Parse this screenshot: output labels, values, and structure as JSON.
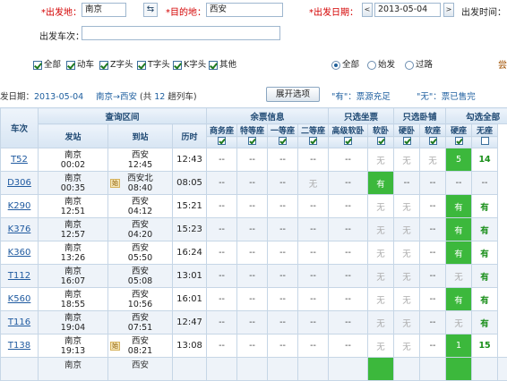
{
  "search": {
    "from_label": "*出发地：",
    "from_value": "南京",
    "swap_glyph": "⇆",
    "to_label": "*目的地：",
    "to_value": "西安",
    "date_label": "*出发日期：",
    "date_prev": "<",
    "date_value": "2013-05-04",
    "date_next": ">",
    "time_label": "出发时间：",
    "train_no_label": "出发车次：",
    "train_no_value": ""
  },
  "filters": {
    "types": [
      {
        "label": "全部",
        "checked": true
      },
      {
        "label": "动车",
        "checked": true
      },
      {
        "label": "Z字头",
        "checked": true
      },
      {
        "label": "T字头",
        "checked": true
      },
      {
        "label": "K字头",
        "checked": true
      },
      {
        "label": "其他",
        "checked": true
      }
    ],
    "station_types": [
      {
        "label": "全部",
        "selected": true
      },
      {
        "label": "始发",
        "selected": false
      },
      {
        "label": "过路",
        "selected": false
      }
    ],
    "edge_char": "尝"
  },
  "info": {
    "date_prefix": "发日期：",
    "date": "2013-05-04",
    "route": "南京→西安",
    "count_prefix": "(共",
    "count": "12",
    "count_suffix": "趟列车)",
    "expand_button": "展开选项",
    "legend_you": "\"有\"：票源充足",
    "legend_wu": "\"无\"：票已售完"
  },
  "table": {
    "group_headers": {
      "train": "车次",
      "interval": "查询区间",
      "remaining": "余票信息",
      "seat_only": "只选坐票",
      "sleeper_only": "只选卧铺",
      "select_all": "勾选全部"
    },
    "sub_headers": {
      "depart": "发站",
      "arrive": "到站",
      "duration": "历时"
    },
    "seat_classes": [
      "商务座",
      "特等座",
      "一等座",
      "二等座",
      "高级软卧",
      "软卧",
      "硬卧",
      "软座",
      "硬座",
      "无座"
    ],
    "seat_checked": [
      true,
      true,
      true,
      true,
      true,
      true,
      true,
      true,
      true,
      false
    ],
    "through_tag": "始",
    "rows": [
      {
        "train": "T52",
        "from": "南京",
        "from_time": "00:02",
        "to": "西安",
        "to_time": "12:45",
        "through": false,
        "duration": "12:43",
        "seats": [
          "--",
          "--",
          "--",
          "--",
          "--",
          "无",
          "无",
          "无",
          "5",
          "14"
        ]
      },
      {
        "train": "D306",
        "from": "南京",
        "from_time": "00:35",
        "to": "西安北",
        "to_time": "08:40",
        "through": true,
        "duration": "08:05",
        "seats": [
          "--",
          "--",
          "--",
          "无",
          "--",
          "有",
          "--",
          "--",
          "--",
          "--"
        ]
      },
      {
        "train": "K290",
        "from": "南京",
        "from_time": "12:51",
        "to": "西安",
        "to_time": "04:12",
        "through": false,
        "duration": "15:21",
        "seats": [
          "--",
          "--",
          "--",
          "--",
          "--",
          "无",
          "无",
          "--",
          "有",
          "有"
        ]
      },
      {
        "train": "K376",
        "from": "南京",
        "from_time": "12:57",
        "to": "西安",
        "to_time": "04:20",
        "through": false,
        "duration": "15:23",
        "seats": [
          "--",
          "--",
          "--",
          "--",
          "--",
          "无",
          "无",
          "--",
          "有",
          "有"
        ]
      },
      {
        "train": "K360",
        "from": "南京",
        "from_time": "13:26",
        "to": "西安",
        "to_time": "05:50",
        "through": false,
        "duration": "16:24",
        "seats": [
          "--",
          "--",
          "--",
          "--",
          "--",
          "无",
          "无",
          "--",
          "有",
          "有"
        ]
      },
      {
        "train": "T112",
        "from": "南京",
        "from_time": "16:07",
        "to": "西安",
        "to_time": "05:08",
        "through": false,
        "duration": "13:01",
        "seats": [
          "--",
          "--",
          "--",
          "--",
          "--",
          "无",
          "无",
          "--",
          "无",
          "有"
        ]
      },
      {
        "train": "K560",
        "from": "南京",
        "from_time": "18:55",
        "to": "西安",
        "to_time": "10:56",
        "through": false,
        "duration": "16:01",
        "seats": [
          "--",
          "--",
          "--",
          "--",
          "--",
          "无",
          "无",
          "--",
          "有",
          "有"
        ]
      },
      {
        "train": "T116",
        "from": "南京",
        "from_time": "19:04",
        "to": "西安",
        "to_time": "07:51",
        "through": false,
        "duration": "12:47",
        "seats": [
          "--",
          "--",
          "--",
          "--",
          "--",
          "无",
          "无",
          "--",
          "无",
          "有"
        ]
      },
      {
        "train": "T138",
        "from": "南京",
        "from_time": "19:13",
        "to": "西安",
        "to_time": "08:21",
        "through": true,
        "duration": "13:08",
        "seats": [
          "--",
          "--",
          "--",
          "--",
          "--",
          "无",
          "无",
          "--",
          "1",
          "15"
        ]
      }
    ],
    "next_row_partial": {
      "from": "南京",
      "to": "西安"
    }
  },
  "colors": {
    "header_blue": "#204a74",
    "link_blue": "#1f5aa0",
    "available_green": "#3cb83c",
    "required_red": "#d40000"
  }
}
